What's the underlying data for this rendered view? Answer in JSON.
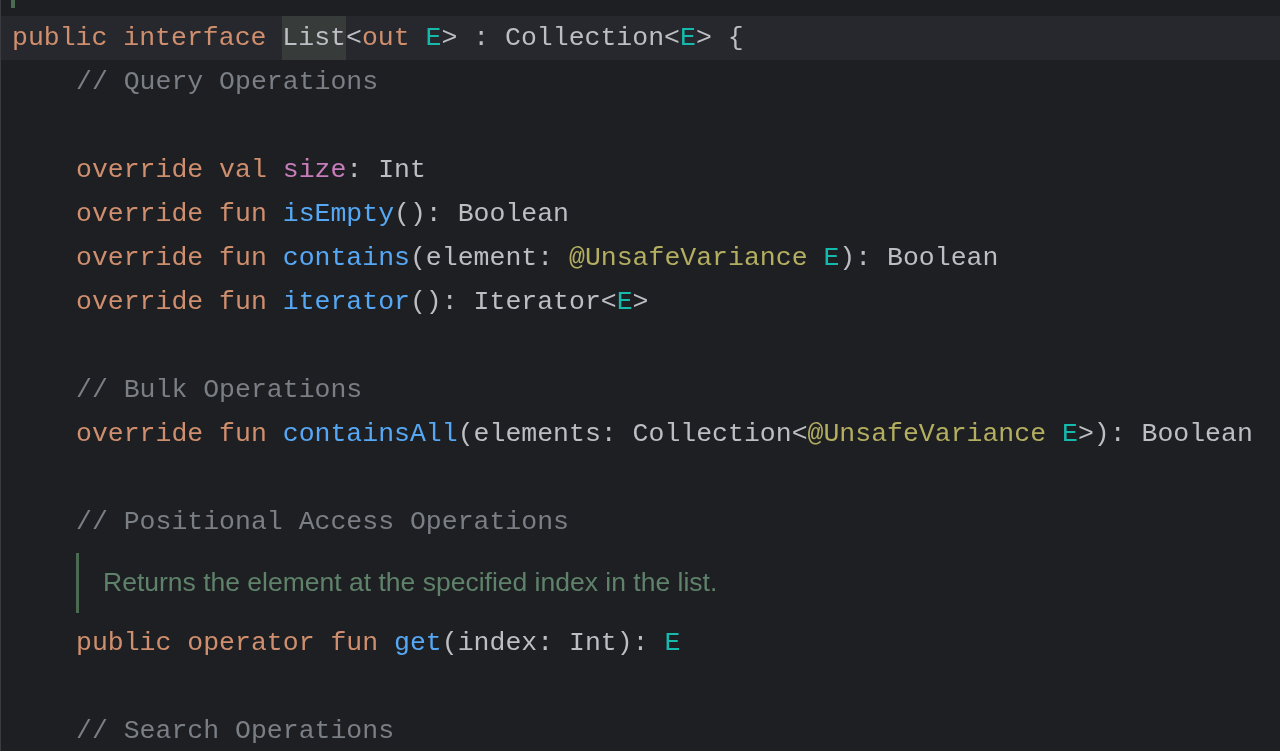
{
  "editor": {
    "declaration": {
      "selected": true,
      "tokens": [
        {
          "text": "public interface ",
          "kind": "keyword"
        },
        {
          "text": "List",
          "kind": "plain",
          "highlighted": true
        },
        {
          "text": "<",
          "kind": "plain"
        },
        {
          "text": "out ",
          "kind": "keyword"
        },
        {
          "text": "E",
          "kind": "typeparam"
        },
        {
          "text": "> : Collection<",
          "kind": "plain"
        },
        {
          "text": "E",
          "kind": "typeparam"
        },
        {
          "text": "> {",
          "kind": "plain"
        }
      ]
    },
    "children": [
      {
        "kind": "code",
        "tokens": [
          {
            "text": "// Query Operations",
            "kind": "comment"
          }
        ]
      },
      {
        "kind": "blank"
      },
      {
        "kind": "code",
        "tokens": [
          {
            "text": "override val ",
            "kind": "keyword"
          },
          {
            "text": "size",
            "kind": "property"
          },
          {
            "text": ": Int",
            "kind": "plain"
          }
        ]
      },
      {
        "kind": "code",
        "tokens": [
          {
            "text": "override fun ",
            "kind": "keyword"
          },
          {
            "text": "isEmpty",
            "kind": "function"
          },
          {
            "text": "(): Boolean",
            "kind": "plain"
          }
        ]
      },
      {
        "kind": "code",
        "tokens": [
          {
            "text": "override fun ",
            "kind": "keyword"
          },
          {
            "text": "contains",
            "kind": "function"
          },
          {
            "text": "(element: ",
            "kind": "plain"
          },
          {
            "text": "@UnsafeVariance ",
            "kind": "annotation"
          },
          {
            "text": "E",
            "kind": "typeparam"
          },
          {
            "text": "): Boolean",
            "kind": "plain"
          }
        ]
      },
      {
        "kind": "code",
        "tokens": [
          {
            "text": "override fun ",
            "kind": "keyword"
          },
          {
            "text": "iterator",
            "kind": "function"
          },
          {
            "text": "(): Iterator<",
            "kind": "plain"
          },
          {
            "text": "E",
            "kind": "typeparam"
          },
          {
            "text": ">",
            "kind": "plain"
          }
        ]
      },
      {
        "kind": "blank"
      },
      {
        "kind": "code",
        "tokens": [
          {
            "text": "// Bulk Operations",
            "kind": "comment"
          }
        ]
      },
      {
        "kind": "code",
        "tokens": [
          {
            "text": "override fun ",
            "kind": "keyword"
          },
          {
            "text": "containsAll",
            "kind": "function"
          },
          {
            "text": "(elements: Collection<",
            "kind": "plain"
          },
          {
            "text": "@UnsafeVariance ",
            "kind": "annotation"
          },
          {
            "text": "E",
            "kind": "typeparam"
          },
          {
            "text": ">): Boolean",
            "kind": "plain"
          }
        ]
      },
      {
        "kind": "blank"
      },
      {
        "kind": "code",
        "tokens": [
          {
            "text": "// Positional Access Operations",
            "kind": "comment"
          }
        ]
      },
      {
        "kind": "doc",
        "text": "Returns the element at the specified index in the list."
      },
      {
        "kind": "code",
        "tokens": [
          {
            "text": "public operator fun ",
            "kind": "keyword"
          },
          {
            "text": "get",
            "kind": "function"
          },
          {
            "text": "(index: Int): ",
            "kind": "plain"
          },
          {
            "text": "E",
            "kind": "typeparam"
          }
        ]
      },
      {
        "kind": "blank"
      },
      {
        "kind": "code",
        "tokens": [
          {
            "text": "// Search Operations",
            "kind": "comment"
          }
        ]
      }
    ]
  }
}
